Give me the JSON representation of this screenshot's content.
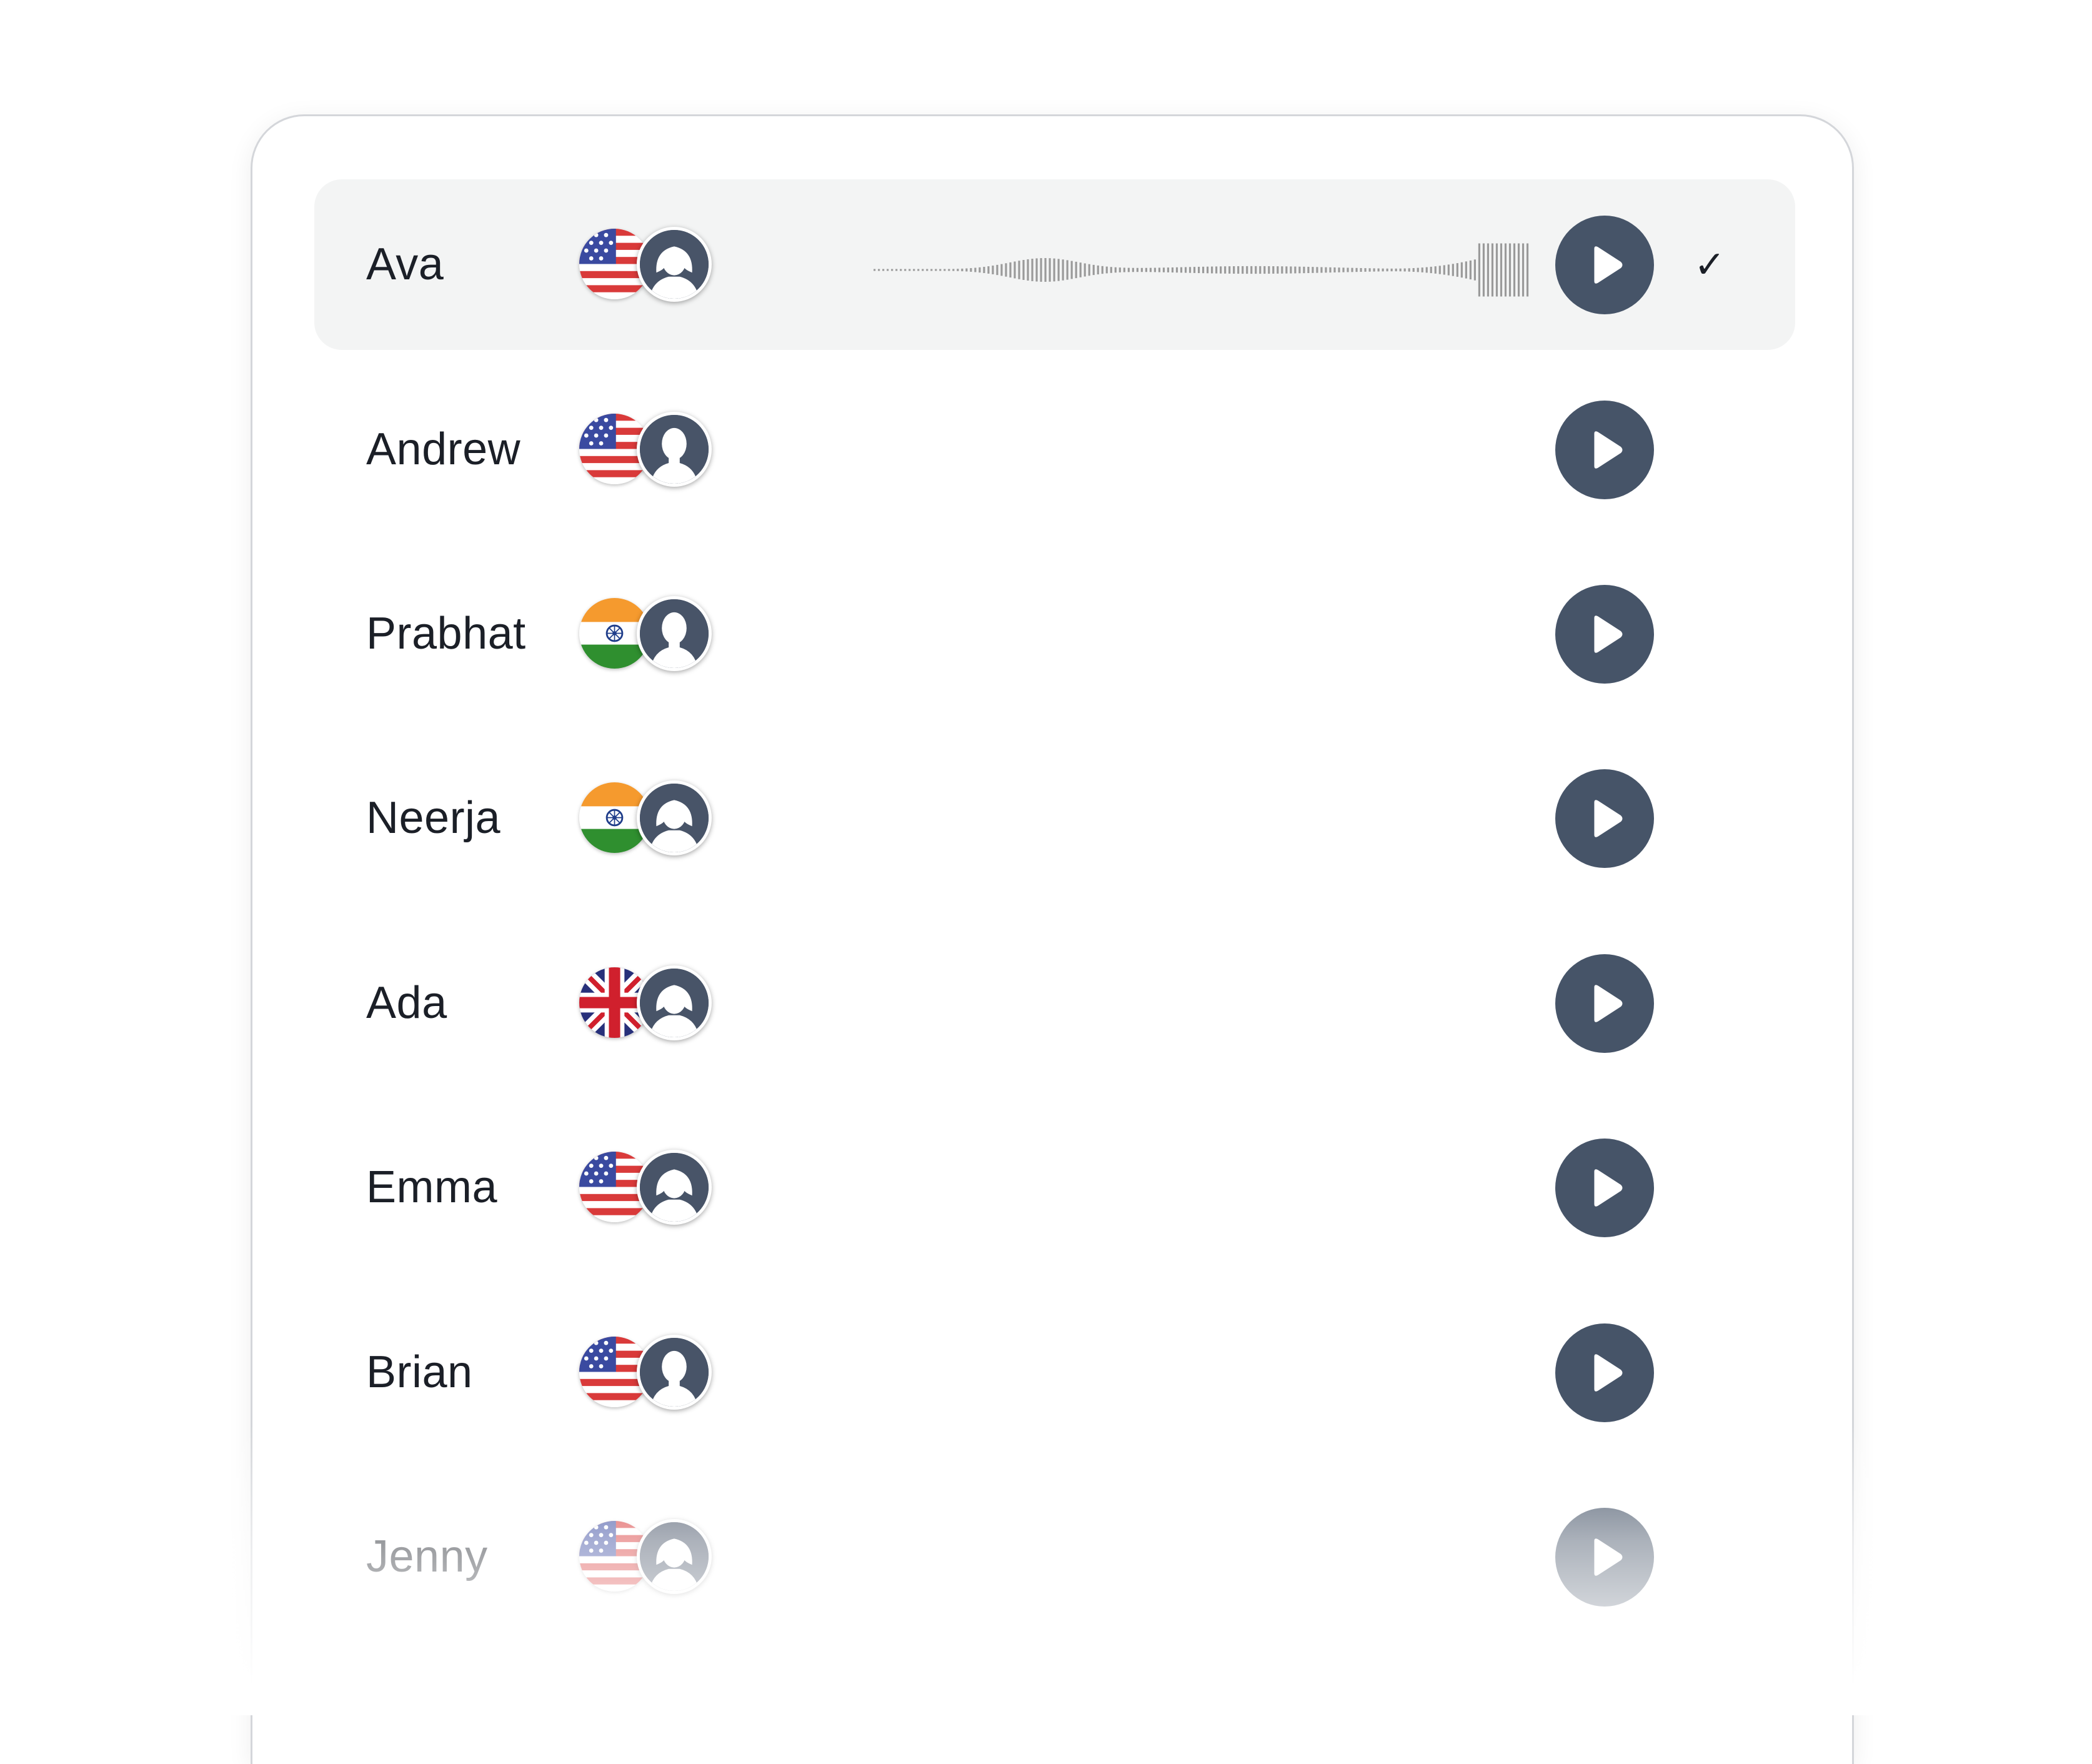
{
  "voices": [
    {
      "name": "Ava",
      "flag": "us",
      "avatar": "female-avatar-icon",
      "selected": true,
      "check": "✓"
    },
    {
      "name": "Andrew",
      "flag": "us",
      "avatar": "male-avatar-icon",
      "selected": false
    },
    {
      "name": "Prabhat",
      "flag": "in",
      "avatar": "male-avatar-icon",
      "selected": false
    },
    {
      "name": "Neerja",
      "flag": "in",
      "avatar": "female-avatar-icon",
      "selected": false
    },
    {
      "name": "Ada",
      "flag": "gb",
      "avatar": "female-avatar-icon",
      "selected": false
    },
    {
      "name": "Emma",
      "flag": "us",
      "avatar": "female-avatar-icon",
      "selected": false
    },
    {
      "name": "Brian",
      "flag": "us",
      "avatar": "male-avatar-icon",
      "selected": false
    },
    {
      "name": "Jenny",
      "flag": "us",
      "avatar": "female-avatar-icon",
      "selected": false
    }
  ],
  "colors": {
    "selected_row_bg": "#f3f4f4",
    "play_button": "#465468",
    "avatar_bg": "#485468",
    "waveform": "#9a9a9a",
    "text": "#1b1f27"
  },
  "icons": {
    "play": "play-icon",
    "check": "checkmark-icon",
    "waveform": "audio-waveform-icon"
  }
}
